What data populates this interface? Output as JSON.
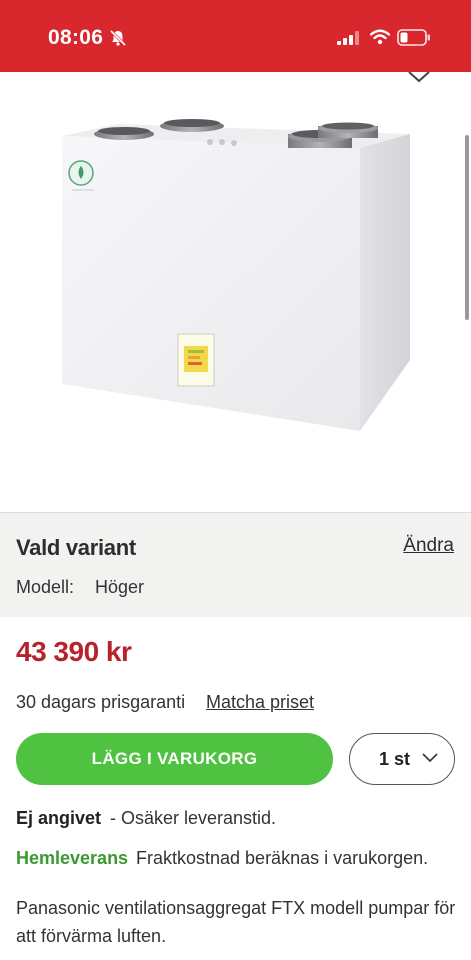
{
  "status_bar": {
    "time": "08:06",
    "icons": [
      "bell-slash-icon",
      "signal-icon",
      "wifi-icon",
      "battery-icon"
    ],
    "background_color": "#d9272e"
  },
  "product": {
    "image_icon": "ventilation-unit-image"
  },
  "variant": {
    "title": "Vald variant",
    "change_label": "Ändra",
    "model_label": "Modell:",
    "model_value": "Höger"
  },
  "price": {
    "amount": "43 390 kr",
    "guarantee_text": "30 dagars prisgaranti",
    "match_label": "Matcha priset",
    "color": "#b8232b"
  },
  "cart": {
    "add_label": "LÄGG I VARUKORG",
    "quantity": "1 st",
    "button_color": "#4fc341"
  },
  "stock": {
    "status": "Ej angivet",
    "note": "- Osäker leveranstid."
  },
  "delivery": {
    "label": "Hemleverans",
    "note": "Fraktkostnad beräknas i varukorgen."
  },
  "description": "Panasonic ventilationsaggregat FTX modell pumpar för att förvärma luften."
}
